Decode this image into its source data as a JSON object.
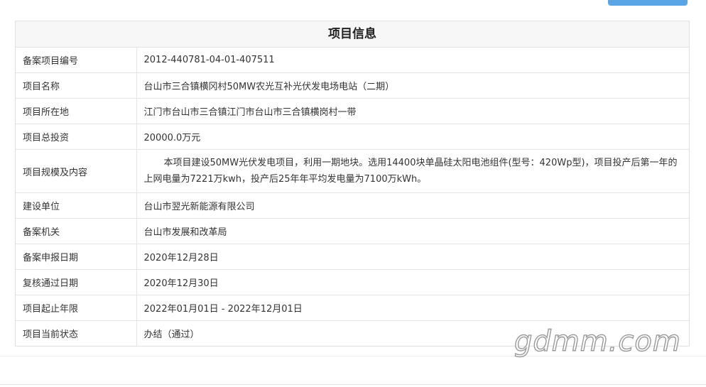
{
  "panel": {
    "title": "项目信息"
  },
  "rows": [
    {
      "label": "备案项目编号",
      "value": "2012-440781-04-01-407511"
    },
    {
      "label": "项目名称",
      "value": "台山市三合镇横冈村50MW农光互补光伏发电场电站（二期）"
    },
    {
      "label": "项目所在地",
      "value": "江门市台山市三合镇江门市台山市三合镇横岗村一带"
    },
    {
      "label": "项目总投资",
      "value": "20000.0万元"
    },
    {
      "label": "项目规模及内容",
      "value": "本项目建设50MW光伏发电项目，利用一期地块。选用14400块单晶硅太阳电池组件(型号：420Wp型)，项目投产后第一年的上网电量为7221万kwh，投产后25年年平均发电量为7100万kWh。"
    },
    {
      "label": "建设单位",
      "value": "台山市翌光新能源有限公司"
    },
    {
      "label": "备案机关",
      "value": "台山市发展和改革局"
    },
    {
      "label": "备案申报日期",
      "value": "2020年12月28日"
    },
    {
      "label": "复核通过日期",
      "value": "2020年12月30日"
    },
    {
      "label": "项目起止年限",
      "value": "2022年01月01日 - 2022年12月01日"
    },
    {
      "label": "项目当前状态",
      "value": "办结（通过）"
    }
  ],
  "watermark": "gdmm.com",
  "colors": {
    "top_button": "#5aa5e6",
    "border": "#e1e1e1",
    "title_bg": "#f7f7f7"
  }
}
